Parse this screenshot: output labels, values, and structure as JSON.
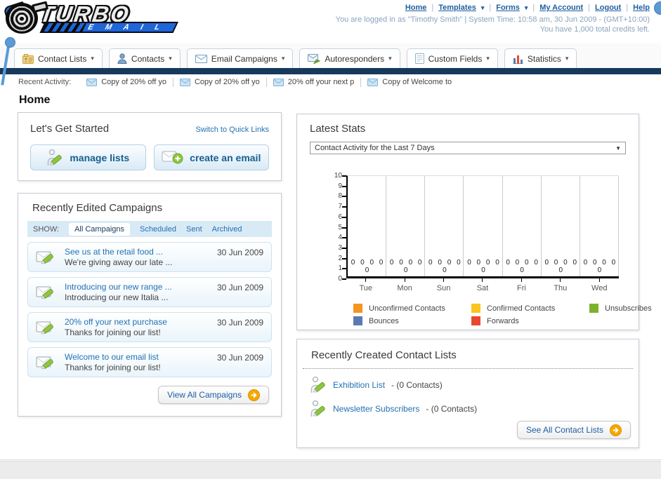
{
  "header": {
    "logo_title": "TURBO",
    "logo_subtitle": "E M A I L",
    "nav": [
      {
        "label": "Home",
        "caret": false
      },
      {
        "label": "Templates",
        "caret": true
      },
      {
        "label": "Forms",
        "caret": true
      },
      {
        "label": "My Account",
        "caret": false
      },
      {
        "label": "Logout",
        "caret": false
      },
      {
        "label": "Help",
        "caret": false
      }
    ],
    "login_line": "You are logged in as \"Timothy Smith\" | System Time: 10:58 am, 30 Jun 2009 - (GMT+10:00)",
    "credits_line": "You have 1,000 total credits left."
  },
  "tabs": [
    {
      "label": "Contact Lists"
    },
    {
      "label": "Contacts"
    },
    {
      "label": "Email Campaigns"
    },
    {
      "label": "Autoresponders"
    },
    {
      "label": "Custom Fields"
    },
    {
      "label": "Statistics"
    }
  ],
  "recent_activity": {
    "label": "Recent Activity:",
    "items": [
      "Copy of 20% off yo",
      "Copy of 20% off yo",
      "20% off your next p",
      "Copy of Welcome to"
    ]
  },
  "page": {
    "title": "Home"
  },
  "get_started": {
    "title": "Let's Get Started",
    "switch_link": "Switch to Quick Links",
    "manage_lists_label": "manage lists",
    "create_email_label": "create an email"
  },
  "campaigns": {
    "title": "Recently Edited Campaigns",
    "filter_label": "SHOW:",
    "filters": [
      "All Campaigns",
      "Scheduled",
      "Sent",
      "Archived"
    ],
    "active_filter": "All Campaigns",
    "items": [
      {
        "title": "See us at the retail food ...",
        "subtitle": "We're giving away our late ...",
        "date": "30 Jun 2009"
      },
      {
        "title": "Introducing our new range ...",
        "subtitle": "Introducing our new Italia ...",
        "date": "30 Jun 2009"
      },
      {
        "title": "20% off your next purchase",
        "subtitle": "Thanks for joining our list!",
        "date": "30 Jun 2009"
      },
      {
        "title": "Welcome to our email list",
        "subtitle": "Thanks for joining our list!",
        "date": "30 Jun 2009"
      }
    ],
    "view_all_label": "View All Campaigns"
  },
  "stats": {
    "title": "Latest Stats",
    "dropdown_value": "Contact Activity for the Last 7 Days"
  },
  "chart_data": {
    "type": "bar",
    "title": "Contact Activity for the Last 7 Days",
    "categories": [
      "Tue",
      "Mon",
      "Sun",
      "Sat",
      "Fri",
      "Thu",
      "Wed"
    ],
    "series": [
      {
        "name": "Unconfirmed Contacts",
        "color": "#f5941e",
        "values": [
          0,
          0,
          0,
          0,
          0,
          0,
          0
        ]
      },
      {
        "name": "Confirmed Contacts",
        "color": "#fac51c",
        "values": [
          0,
          0,
          0,
          0,
          0,
          0,
          0
        ]
      },
      {
        "name": "Unsubscribes",
        "color": "#7cb22a",
        "values": [
          0,
          0,
          0,
          0,
          0,
          0,
          0
        ]
      },
      {
        "name": "Bounces",
        "color": "#5c79b2",
        "values": [
          0,
          0,
          0,
          0,
          0,
          0,
          0
        ]
      },
      {
        "name": "Forwards",
        "color": "#e8492c",
        "values": [
          0,
          0,
          0,
          0,
          0,
          0,
          0
        ]
      }
    ],
    "ylim": [
      0,
      10
    ],
    "ytick_step": 1,
    "grid": "vertical",
    "show_value_labels": true,
    "legend_position": "bottom"
  },
  "contact_lists": {
    "title": "Recently Created Contact Lists",
    "items": [
      {
        "name": "Exhibition List",
        "detail": "- (0 Contacts)"
      },
      {
        "name": "Newsletter Subscribers",
        "detail": "- (0 Contacts)"
      }
    ],
    "see_all_label": "See All Contact Lists"
  }
}
